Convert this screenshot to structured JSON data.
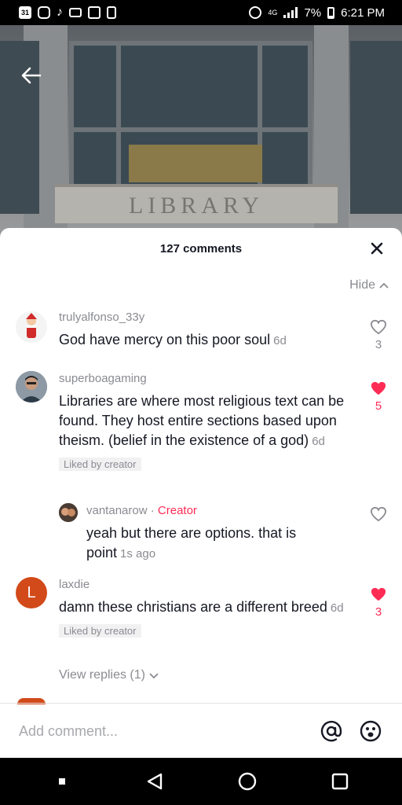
{
  "status_bar": {
    "time": "6:21 PM",
    "battery": "7%",
    "calendar_day": "31",
    "network": "4G",
    "left_icons": [
      "calendar-icon",
      "instagram-icon",
      "tiktok-icon",
      "voicemail-icon",
      "image-icon",
      "battery-saver-icon"
    ],
    "right_icons": [
      "alarm-icon",
      "4g-icon",
      "signal-icon",
      "battery-icon"
    ]
  },
  "video": {
    "sign_text": "LIBRARY"
  },
  "comments_panel": {
    "count_label": "127 comments",
    "hide_label": "Hide",
    "comments": [
      {
        "username": "trulyalfonso_33y",
        "text": "God have mercy on this poor soul",
        "time": "6d",
        "likes": "3",
        "liked": false
      },
      {
        "username": "superboagaming",
        "text": "Libraries are where most religious text can be found. They host entire sections based upon theism. (belief in the existence of a god)",
        "time": "6d",
        "likes": "5",
        "liked": true,
        "badge": "Liked by creator"
      },
      {
        "username": "laxdie",
        "avatar_letter": "L",
        "text": "damn these christians are a different breed",
        "time": "6d",
        "likes": "3",
        "liked": true,
        "badge": "Liked by creator",
        "view_replies": "View replies (1)"
      }
    ],
    "reply": {
      "username": "vantanarow",
      "separator": "·",
      "creator_label": "Creator",
      "text": "yeah but there are options. that is point",
      "time": "1s ago"
    },
    "add_comment_placeholder": "Add comment..."
  },
  "colors": {
    "accent_red": "#fe2c55",
    "muted_text": "#8a8b91",
    "avatar_l": "#d24a1a"
  }
}
